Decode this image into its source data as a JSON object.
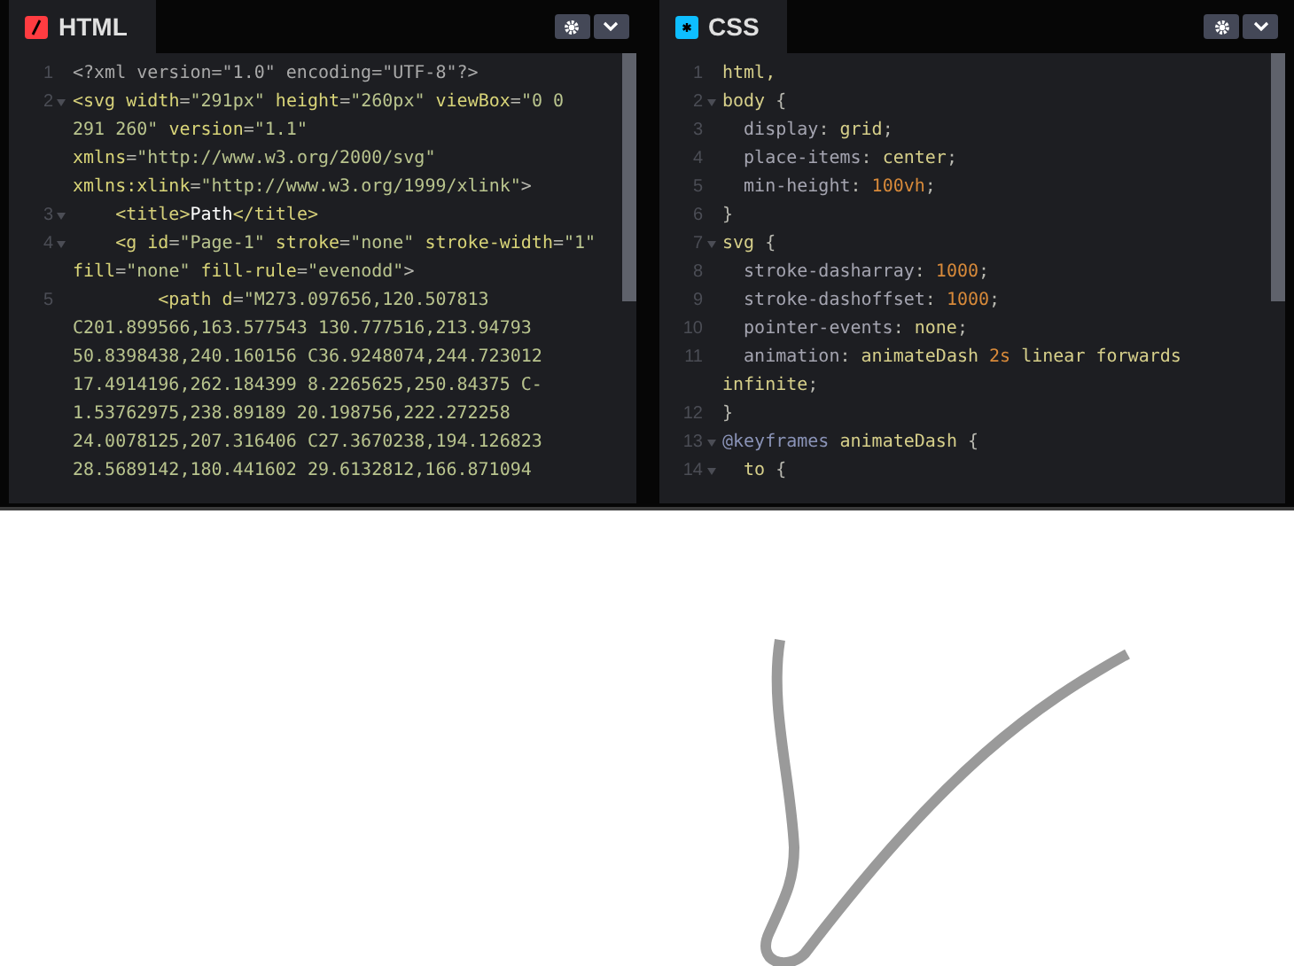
{
  "panels": [
    {
      "title": "HTML",
      "kind": "html",
      "lines": [
        {
          "number": "1",
          "foldable": false,
          "rows": [
            {
              "tokens": [
                {
                  "t": "<?xml version=\"1.0\" encoding=\"UTF-8\"?>",
                  "kind": "meta"
                }
              ]
            }
          ]
        },
        {
          "number": "2",
          "foldable": true,
          "rows": [
            {
              "tokens": [
                {
                  "t": "<svg",
                  "kind": "tag"
                },
                {
                  "t": " width",
                  "kind": "attr"
                },
                {
                  "t": "=",
                  "kind": "punct"
                },
                {
                  "t": "\"291px\"",
                  "kind": "str"
                },
                {
                  "t": " height",
                  "kind": "attr"
                },
                {
                  "t": "=",
                  "kind": "punct"
                },
                {
                  "t": "\"260px\"",
                  "kind": "str"
                },
                {
                  "t": " viewBox",
                  "kind": "attr"
                },
                {
                  "t": "=",
                  "kind": "punct"
                },
                {
                  "t": "\"0 0",
                  "kind": "str"
                }
              ]
            },
            {
              "tokens": [
                {
                  "t": "291 260\"",
                  "kind": "str"
                },
                {
                  "t": " version",
                  "kind": "attr"
                },
                {
                  "t": "=",
                  "kind": "punct"
                },
                {
                  "t": "\"1.1\"",
                  "kind": "str"
                }
              ]
            },
            {
              "tokens": [
                {
                  "t": "xmlns",
                  "kind": "attr"
                },
                {
                  "t": "=",
                  "kind": "punct"
                },
                {
                  "t": "\"http://www.w3.org/2000/svg\"",
                  "kind": "str"
                }
              ]
            },
            {
              "tokens": [
                {
                  "t": "xmlns:xlink",
                  "kind": "attr"
                },
                {
                  "t": "=",
                  "kind": "punct"
                },
                {
                  "t": "\"http://www.w3.org/1999/xlink\"",
                  "kind": "str"
                },
                {
                  "t": ">",
                  "kind": "punct"
                }
              ]
            }
          ]
        },
        {
          "number": "3",
          "foldable": true,
          "rows": [
            {
              "tokens": [
                {
                  "t": "    <title>",
                  "kind": "tag"
                },
                {
                  "t": "Path",
                  "kind": "text"
                },
                {
                  "t": "</title>",
                  "kind": "tag"
                }
              ]
            }
          ]
        },
        {
          "number": "4",
          "foldable": true,
          "rows": [
            {
              "tokens": [
                {
                  "t": "    <g",
                  "kind": "tag"
                },
                {
                  "t": " id",
                  "kind": "attr"
                },
                {
                  "t": "=",
                  "kind": "punct"
                },
                {
                  "t": "\"Page-1\"",
                  "kind": "str"
                },
                {
                  "t": " stroke",
                  "kind": "attr"
                },
                {
                  "t": "=",
                  "kind": "punct"
                },
                {
                  "t": "\"none\"",
                  "kind": "str"
                },
                {
                  "t": " stroke-width",
                  "kind": "attr"
                },
                {
                  "t": "=",
                  "kind": "punct"
                },
                {
                  "t": "\"1\"",
                  "kind": "str"
                }
              ]
            },
            {
              "tokens": [
                {
                  "t": "fill",
                  "kind": "attr"
                },
                {
                  "t": "=",
                  "kind": "punct"
                },
                {
                  "t": "\"none\"",
                  "kind": "str"
                },
                {
                  "t": " fill-rule",
                  "kind": "attr"
                },
                {
                  "t": "=",
                  "kind": "punct"
                },
                {
                  "t": "\"evenodd\"",
                  "kind": "str"
                },
                {
                  "t": ">",
                  "kind": "punct"
                }
              ]
            }
          ]
        },
        {
          "number": "5",
          "foldable": false,
          "rows": [
            {
              "tokens": [
                {
                  "t": "        <path",
                  "kind": "tag"
                },
                {
                  "t": " d",
                  "kind": "attr"
                },
                {
                  "t": "=",
                  "kind": "punct"
                },
                {
                  "t": "\"M273.097656,120.507813",
                  "kind": "str"
                }
              ]
            },
            {
              "tokens": [
                {
                  "t": "C201.899566,163.577543 130.777516,213.94793",
                  "kind": "str"
                }
              ]
            },
            {
              "tokens": [
                {
                  "t": "50.8398438,240.160156 C36.9248074,244.723012",
                  "kind": "str"
                }
              ]
            },
            {
              "tokens": [
                {
                  "t": "17.4914196,262.184399 8.2265625,250.84375 C-",
                  "kind": "str"
                }
              ]
            },
            {
              "tokens": [
                {
                  "t": "1.53762975,238.89189 20.198756,222.272258",
                  "kind": "str"
                }
              ]
            },
            {
              "tokens": [
                {
                  "t": "24.0078125,207.316406 C27.3670238,194.126823",
                  "kind": "str"
                }
              ]
            },
            {
              "tokens": [
                {
                  "t": "28.5689142,180.441602 29.6132812,166.871094",
                  "kind": "str"
                }
              ]
            }
          ]
        }
      ]
    },
    {
      "title": "CSS",
      "kind": "css",
      "lines": [
        {
          "number": "1",
          "foldable": false,
          "rows": [
            {
              "tokens": [
                {
                  "t": "html,",
                  "kind": "sel"
                }
              ]
            }
          ]
        },
        {
          "number": "2",
          "foldable": true,
          "rows": [
            {
              "tokens": [
                {
                  "t": "body",
                  "kind": "sel"
                },
                {
                  "t": " {",
                  "kind": "punct"
                }
              ]
            }
          ]
        },
        {
          "number": "3",
          "foldable": false,
          "rows": [
            {
              "tokens": [
                {
                  "t": "  display",
                  "kind": "prop"
                },
                {
                  "t": ": ",
                  "kind": "punct"
                },
                {
                  "t": "grid",
                  "kind": "val"
                },
                {
                  "t": ";",
                  "kind": "punct"
                }
              ]
            }
          ]
        },
        {
          "number": "4",
          "foldable": false,
          "rows": [
            {
              "tokens": [
                {
                  "t": "  place-items",
                  "kind": "prop"
                },
                {
                  "t": ": ",
                  "kind": "punct"
                },
                {
                  "t": "center",
                  "kind": "val"
                },
                {
                  "t": ";",
                  "kind": "punct"
                }
              ]
            }
          ]
        },
        {
          "number": "5",
          "foldable": false,
          "rows": [
            {
              "tokens": [
                {
                  "t": "  min-height",
                  "kind": "prop"
                },
                {
                  "t": ": ",
                  "kind": "punct"
                },
                {
                  "t": "100vh",
                  "kind": "num"
                },
                {
                  "t": ";",
                  "kind": "punct"
                }
              ]
            }
          ]
        },
        {
          "number": "6",
          "foldable": false,
          "rows": [
            {
              "tokens": [
                {
                  "t": "}",
                  "kind": "punct"
                }
              ]
            }
          ]
        },
        {
          "number": "7",
          "foldable": true,
          "rows": [
            {
              "tokens": [
                {
                  "t": "svg",
                  "kind": "sel"
                },
                {
                  "t": " {",
                  "kind": "punct"
                }
              ]
            }
          ]
        },
        {
          "number": "8",
          "foldable": false,
          "rows": [
            {
              "tokens": [
                {
                  "t": "  stroke-dasharray",
                  "kind": "prop"
                },
                {
                  "t": ": ",
                  "kind": "punct"
                },
                {
                  "t": "1000",
                  "kind": "num"
                },
                {
                  "t": ";",
                  "kind": "punct"
                }
              ]
            }
          ]
        },
        {
          "number": "9",
          "foldable": false,
          "rows": [
            {
              "tokens": [
                {
                  "t": "  stroke-dashoffset",
                  "kind": "prop"
                },
                {
                  "t": ": ",
                  "kind": "punct"
                },
                {
                  "t": "1000",
                  "kind": "num"
                },
                {
                  "t": ";",
                  "kind": "punct"
                }
              ]
            }
          ]
        },
        {
          "number": "10",
          "foldable": false,
          "rows": [
            {
              "tokens": [
                {
                  "t": "  pointer-events",
                  "kind": "prop"
                },
                {
                  "t": ": ",
                  "kind": "punct"
                },
                {
                  "t": "none",
                  "kind": "val"
                },
                {
                  "t": ";",
                  "kind": "punct"
                }
              ]
            }
          ]
        },
        {
          "number": "11",
          "foldable": false,
          "rows": [
            {
              "tokens": [
                {
                  "t": "  animation",
                  "kind": "prop"
                },
                {
                  "t": ": ",
                  "kind": "punct"
                },
                {
                  "t": "animateDash",
                  "kind": "val"
                },
                {
                  "t": " 2s",
                  "kind": "num"
                },
                {
                  "t": " linear forwards",
                  "kind": "val"
                }
              ]
            },
            {
              "tokens": [
                {
                  "t": "infinite",
                  "kind": "val"
                },
                {
                  "t": ";",
                  "kind": "punct"
                }
              ]
            }
          ]
        },
        {
          "number": "12",
          "foldable": false,
          "rows": [
            {
              "tokens": [
                {
                  "t": "}",
                  "kind": "punct"
                }
              ]
            }
          ]
        },
        {
          "number": "13",
          "foldable": true,
          "rows": [
            {
              "tokens": [
                {
                  "t": "@keyframes",
                  "kind": "at"
                },
                {
                  "t": " animateDash",
                  "kind": "val"
                },
                {
                  "t": " {",
                  "kind": "punct"
                }
              ]
            }
          ]
        },
        {
          "number": "14",
          "foldable": true,
          "rows": [
            {
              "tokens": [
                {
                  "t": "  to",
                  "kind": "sel"
                },
                {
                  "t": " {",
                  "kind": "punct"
                }
              ]
            }
          ]
        }
      ]
    }
  ]
}
